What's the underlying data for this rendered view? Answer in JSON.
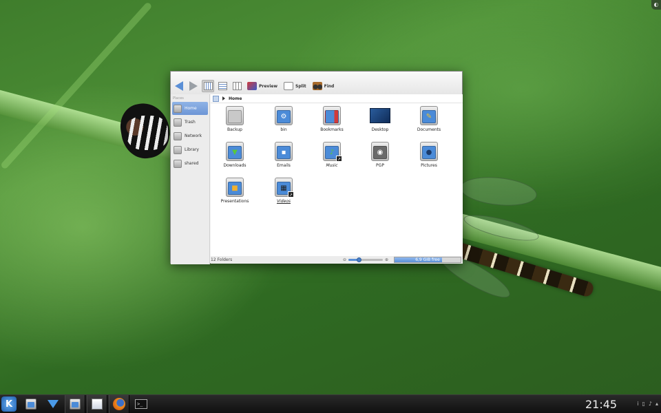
{
  "corner_icon": "plasma-cashew-icon",
  "toolbar": {
    "back_icon": "back-arrow-icon",
    "forward_icon": "forward-arrow-icon",
    "preview_label": "Preview",
    "split_label": "Split",
    "find_label": "Find"
  },
  "places": {
    "title": "Places",
    "items": [
      {
        "label": "Home",
        "active": true
      },
      {
        "label": "Trash",
        "active": false
      },
      {
        "label": "Network",
        "active": false
      },
      {
        "label": "Library",
        "active": false
      },
      {
        "label": "shared",
        "active": false
      }
    ]
  },
  "breadcrumb": {
    "location": "Home"
  },
  "files": [
    {
      "label": "Backup",
      "style": "normal"
    },
    {
      "label": "bin",
      "style": "normal"
    },
    {
      "label": "Bookmarks",
      "style": "normal"
    },
    {
      "label": "Desktop",
      "style": "normal"
    },
    {
      "label": "Documents",
      "style": "normal"
    },
    {
      "label": "Downloads",
      "style": "normal"
    },
    {
      "label": "Emails",
      "style": "normal"
    },
    {
      "label": "Music",
      "style": "italic"
    },
    {
      "label": "PGP",
      "style": "normal"
    },
    {
      "label": "Pictures",
      "style": "normal"
    },
    {
      "label": "Presentations",
      "style": "normal"
    },
    {
      "label": "Videos",
      "style": "link"
    }
  ],
  "status": {
    "folder_count": "12 Folders",
    "zoom_level": 0.3,
    "free_space_text": "6,9 GiB free",
    "free_space_used_fraction": 0.72
  },
  "taskbar": {
    "launcher_glyph": "K",
    "terminal_glyph": ">_",
    "clock": "21:45"
  },
  "colors": {
    "accent": "#5a8fd6",
    "desktop_green": "#3f7d2c"
  }
}
